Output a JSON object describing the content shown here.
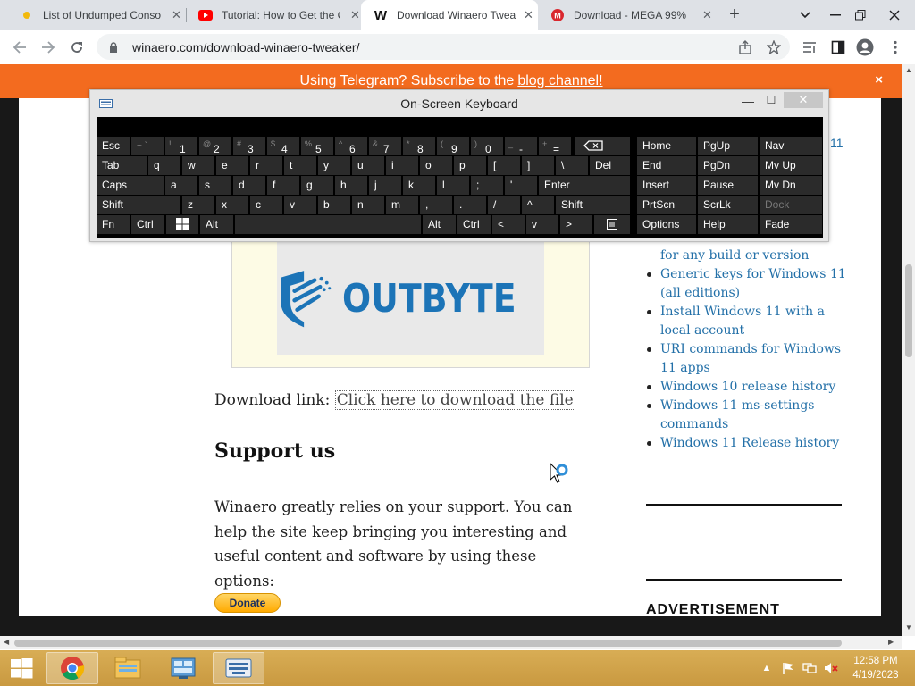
{
  "browser": {
    "tabs": [
      {
        "title": "List of Undumped Conso",
        "icon": "yellow-dot-icon",
        "active": false
      },
      {
        "title": "Tutorial: How to Get the C",
        "icon": "youtube-icon",
        "active": false
      },
      {
        "title": "Download Winaero Twea",
        "icon": "winaero-w-icon",
        "active": true
      },
      {
        "title": "Download - MEGA 99%",
        "icon": "mega-icon",
        "active": false
      }
    ],
    "new_tab_label": "+",
    "url": "winaero.com/download-winaero-tweaker/"
  },
  "banner": {
    "text": "Using Telegram? Subscribe to the ",
    "link": "blog channel!",
    "close": "×"
  },
  "article": {
    "logo_text": "OUTBYTE",
    "download_label": "Download link: ",
    "download_link": "Click here to download the file",
    "support_heading": "Support us",
    "support_text": "Winaero greatly relies on your support. You can help the site keep bringing you interesting and useful content and software by using these options:",
    "donate_label": "Donate"
  },
  "sidebar": {
    "partial_top": "11",
    "partial_item": "for any build or version",
    "items": [
      "Generic keys for Windows 11 (all editions)",
      "Install Windows 11 with a local account",
      "URI commands for Windows 11 apps",
      "Windows 10 release history",
      "Windows 11 ms-settings commands",
      "Windows 11 Release history"
    ],
    "advertisement_heading": "ADVERTISEMENT"
  },
  "osk": {
    "title": "On-Screen Keyboard",
    "rows": {
      "r1": [
        "Esc",
        "1",
        "2",
        "3",
        "4",
        "5",
        "6",
        "7",
        "8",
        "9",
        "0",
        "-",
        "="
      ],
      "r1_shift": [
        "~ `",
        "!",
        "@",
        "#",
        "$",
        "%",
        "^",
        "&",
        "*",
        "(",
        ")",
        "_",
        "+"
      ],
      "r2": [
        "Tab",
        "q",
        "w",
        "e",
        "r",
        "t",
        "y",
        "u",
        "i",
        "o",
        "p",
        "[",
        "]",
        "\\",
        "Del"
      ],
      "r3": [
        "Caps",
        "a",
        "s",
        "d",
        "f",
        "g",
        "h",
        "j",
        "k",
        "l",
        ";",
        "'",
        "Enter"
      ],
      "r4": [
        "Shift",
        "z",
        "x",
        "c",
        "v",
        "b",
        "n",
        "m",
        ",",
        ".",
        "/",
        "^",
        "Shift"
      ],
      "r5": [
        "Fn",
        "Ctrl",
        "Alt",
        "Alt",
        "Ctrl",
        "<",
        "v",
        ">"
      ]
    },
    "nav": [
      [
        "Home",
        "PgUp",
        "Nav"
      ],
      [
        "End",
        "PgDn",
        "Mv Up"
      ],
      [
        "Insert",
        "Pause",
        "Mv Dn"
      ],
      [
        "PrtScn",
        "ScrLk",
        "Dock"
      ],
      [
        "Options",
        "Help",
        "Fade"
      ]
    ]
  },
  "taskbar": {
    "time": "12:58 PM",
    "date": "4/19/2023",
    "apps": [
      "start-button",
      "chrome-icon",
      "file-explorer-icon",
      "control-panel-icon",
      "on-screen-keyboard-icon"
    ]
  }
}
